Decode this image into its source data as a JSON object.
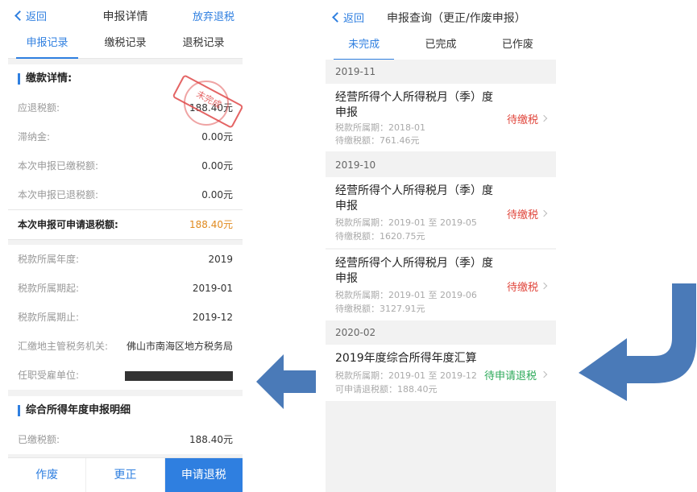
{
  "left": {
    "header": {
      "back_label": "返回",
      "title": "申报详情",
      "action_label": "放弃退税"
    },
    "tabs": [
      {
        "label": "申报记录",
        "active": true
      },
      {
        "label": "缴税记录",
        "active": false
      },
      {
        "label": "退税记录",
        "active": false
      }
    ],
    "payment": {
      "title": "缴款详情:",
      "rows": [
        {
          "label": "应退税额:",
          "value": "188.40元"
        },
        {
          "label": "滞纳金:",
          "value": "0.00元"
        },
        {
          "label": "本次申报已缴税额:",
          "value": "0.00元"
        },
        {
          "label": "本次申报已退税额:",
          "value": "0.00元"
        }
      ],
      "highlight": {
        "label": "本次申报可申请退税额:",
        "value": "188.40元"
      },
      "stamp_text": "未完成"
    },
    "period": {
      "rows": [
        {
          "label": "税款所属年度:",
          "value": "2019"
        },
        {
          "label": "税款所属期起:",
          "value": "2019-01"
        },
        {
          "label": "税款所属期止:",
          "value": "2019-12"
        },
        {
          "label": "汇缴地主管税务机关:",
          "value": "佛山市南海区地方税务局"
        }
      ],
      "employer_label": "任职受雇单位:"
    },
    "annual": {
      "title": "综合所得年度申报明细",
      "rows": [
        {
          "label": "已缴税额:",
          "value": "188.40元"
        }
      ]
    },
    "bottom": {
      "void_label": "作废",
      "correct_label": "更正",
      "refund_label": "申请退税"
    }
  },
  "right": {
    "header": {
      "back_label": "返回",
      "title": "申报查询（更正/作废申报）"
    },
    "tabs": [
      {
        "label": "未完成",
        "active": true
      },
      {
        "label": "已完成",
        "active": false
      },
      {
        "label": "已作废",
        "active": false
      }
    ],
    "groups": [
      {
        "period": "2019-11",
        "items": [
          {
            "title": "经营所得个人所得税月（季）度申报",
            "line1": "税款所属期：2018-01",
            "line2": "待缴税额：761.46元",
            "status": "待缴税"
          }
        ]
      },
      {
        "period": "2019-10",
        "items": [
          {
            "title": "经营所得个人所得税月（季）度申报",
            "line1": "税款所属期：2019-01 至 2019-05",
            "line2": "待缴税额：1620.75元",
            "status": "待缴税"
          },
          {
            "title": "经营所得个人所得税月（季）度申报",
            "line1": "税款所属期：2019-01 至 2019-06",
            "line2": "待缴税额：3127.91元",
            "status": "待缴税"
          }
        ]
      },
      {
        "period": "2020-02",
        "items": [
          {
            "title": "2019年度综合所得年度汇算",
            "line1": "税款所属期：2019-01 至 2019-12",
            "line2": "可申请退税额：188.40元",
            "status": "待申请退税"
          }
        ]
      }
    ]
  },
  "colors": {
    "accent": "#2f7fe0",
    "arrow": "#4a7ab8",
    "pending_pay": "#e0463c",
    "pending_refund": "#2daa5a",
    "highlight_value": "#e08a1e"
  },
  "icons": [
    "back-chevron-icon",
    "chevron-right-icon",
    "left-arrow-icon",
    "curved-arrow-icon"
  ]
}
